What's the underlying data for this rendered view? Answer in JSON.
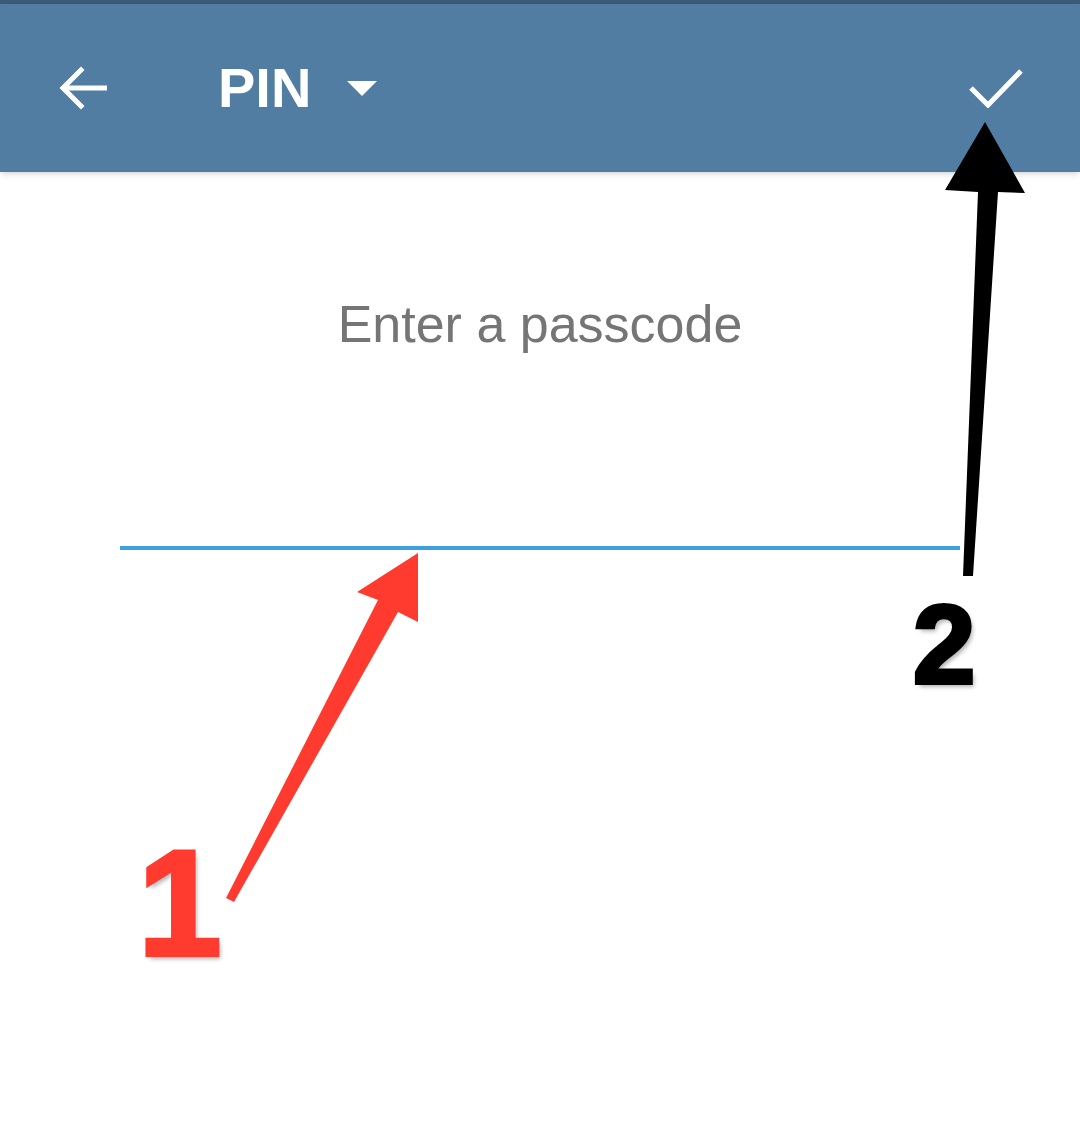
{
  "app_bar": {
    "title": "PIN"
  },
  "prompt": "Enter a passcode",
  "passcode_field": {
    "focused": true
  },
  "annotations": [
    {
      "label": "1",
      "color": "#ff3b30"
    },
    {
      "label": "2",
      "color": "#000000"
    }
  ]
}
